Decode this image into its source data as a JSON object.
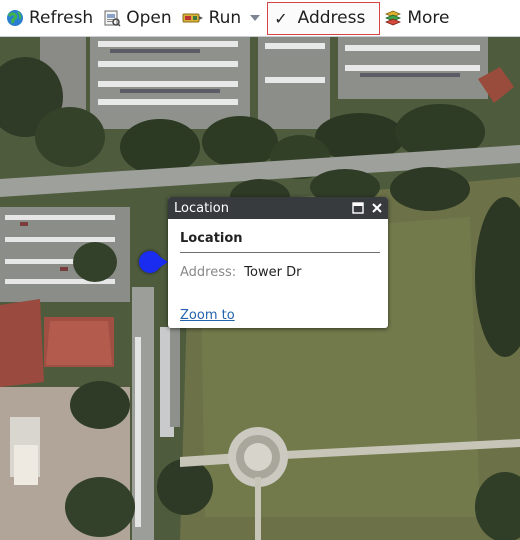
{
  "toolbar": {
    "refresh_label": "Refresh",
    "open_label": "Open",
    "run_label": "Run",
    "address_check": "✓",
    "address_label": "Address",
    "more_label": "More"
  },
  "popup": {
    "header_title": "Location",
    "title": "Location",
    "field_label": "Address:",
    "field_value": "Tower Dr",
    "zoom_link": "Zoom to"
  },
  "colors": {
    "locator": "#1a2cf0",
    "header_bg": "#383b3e",
    "address_border": "#d64545",
    "link": "#2463ad"
  },
  "icons": [
    "globe-refresh-icon",
    "open-document-icon",
    "run-icon",
    "chevron-down-icon",
    "checkmark-icon",
    "stack-icon",
    "maximize-icon",
    "close-icon"
  ]
}
